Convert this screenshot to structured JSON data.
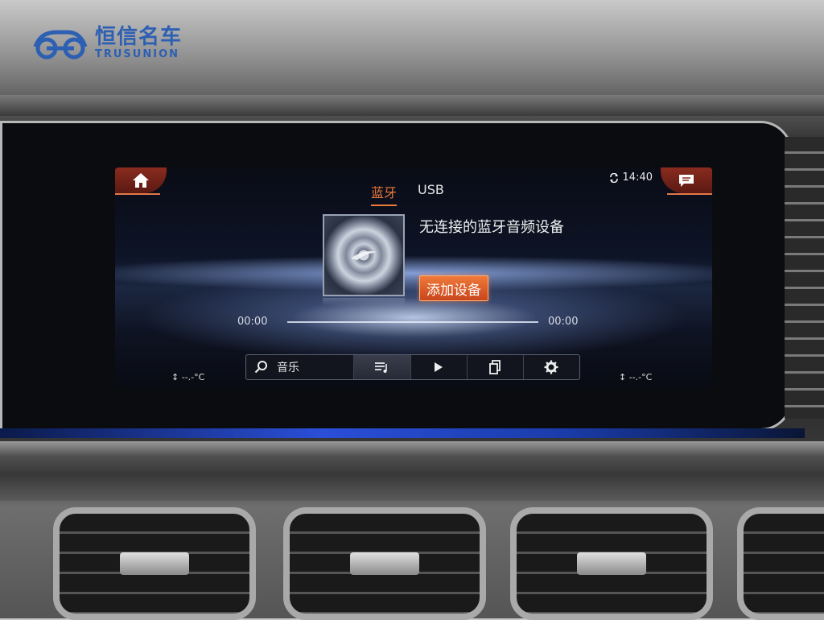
{
  "watermark": {
    "cn": "恒信名车",
    "en": "TRUSUNION"
  },
  "status": {
    "time": "14:40"
  },
  "tabs": [
    {
      "label": "蓝牙",
      "active": true
    },
    {
      "label": "USB",
      "active": false
    }
  ],
  "media": {
    "message": "无连接的蓝牙音频设备",
    "add_device_label": "添加设备",
    "elapsed": "00:00",
    "total": "00:00",
    "progress": 0
  },
  "bottom_bar": {
    "search_label": "音乐"
  },
  "climate": {
    "left_temp": "--.-°C",
    "right_temp": "--.-°C"
  },
  "colors": {
    "accent": "#ef7a3c",
    "brand": "#2d5fb3"
  }
}
